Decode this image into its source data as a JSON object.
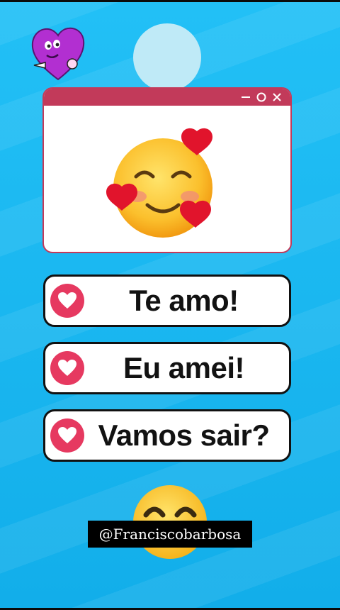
{
  "window": {
    "controls": {
      "minimize": "minimize-icon",
      "maximize": "maximize-icon",
      "close": "close-icon"
    },
    "content_icon": "smiling-face-with-hearts-emoji"
  },
  "options": [
    {
      "label": "Te amo!",
      "icon": "heart-icon"
    },
    {
      "label": "Eu amei!",
      "icon": "heart-icon"
    },
    {
      "label": "Vamos sair?",
      "icon": "heart-icon"
    }
  ],
  "watermark": "@Franciscobarbosa",
  "colors": {
    "background": "#1cb8f2",
    "window_frame": "#c23a5a",
    "heart_badge": "#e63960",
    "option_border": "#111111"
  }
}
